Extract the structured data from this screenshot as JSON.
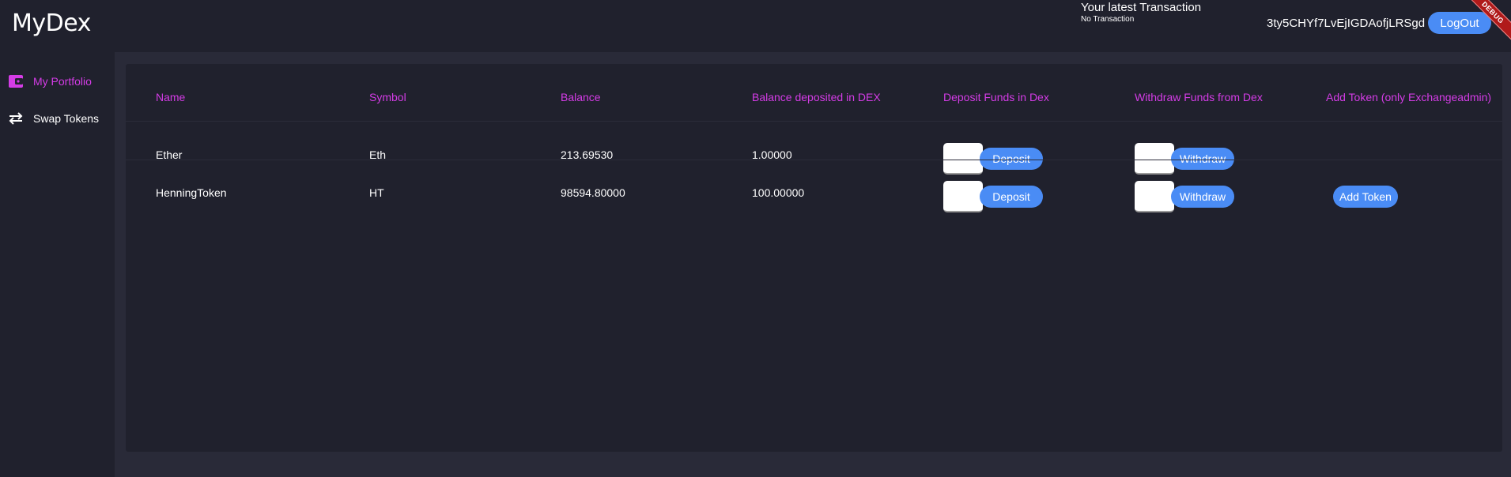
{
  "app": {
    "title": "MyDex",
    "debug_label": "DEBUG"
  },
  "header": {
    "latest_tx_title": "Your latest Transaction",
    "latest_tx_value": "No Transaction",
    "address": "3ty5CHYf7LvEjIGDAofjLRSgd",
    "logout_label": "LogOut"
  },
  "sidebar": {
    "items": [
      {
        "label": "My Portfolio",
        "icon": "wallet-icon",
        "active": true
      },
      {
        "label": "Swap Tokens",
        "icon": "swap-arrows-icon",
        "active": false
      }
    ]
  },
  "table": {
    "headers": [
      "Name",
      "Symbol",
      "Balance",
      "Balance deposited in DEX",
      "Deposit Funds in Dex",
      "Withdraw Funds from Dex",
      "Add Token (only Exchangeadmin)"
    ],
    "rows": [
      {
        "name": "Ether",
        "symbol": "Eth",
        "balance": "213.69530",
        "dex_balance": "1.00000",
        "deposit_value": "",
        "deposit_label": "Deposit",
        "withdraw_value": "",
        "withdraw_label": "Withdraw",
        "add_token_label": ""
      },
      {
        "name": "HenningToken",
        "symbol": "HT",
        "balance": "98594.80000",
        "dex_balance": "100.00000",
        "deposit_value": "",
        "deposit_label": "Deposit",
        "withdraw_value": "",
        "withdraw_label": "Withdraw",
        "add_token_label": "Add Token"
      }
    ]
  },
  "colors": {
    "accent_purple": "#d43ce6",
    "button_blue": "#4a8cf5",
    "background": "#20212d",
    "panel": "#292a38",
    "debug_red": "#b01a1a"
  }
}
